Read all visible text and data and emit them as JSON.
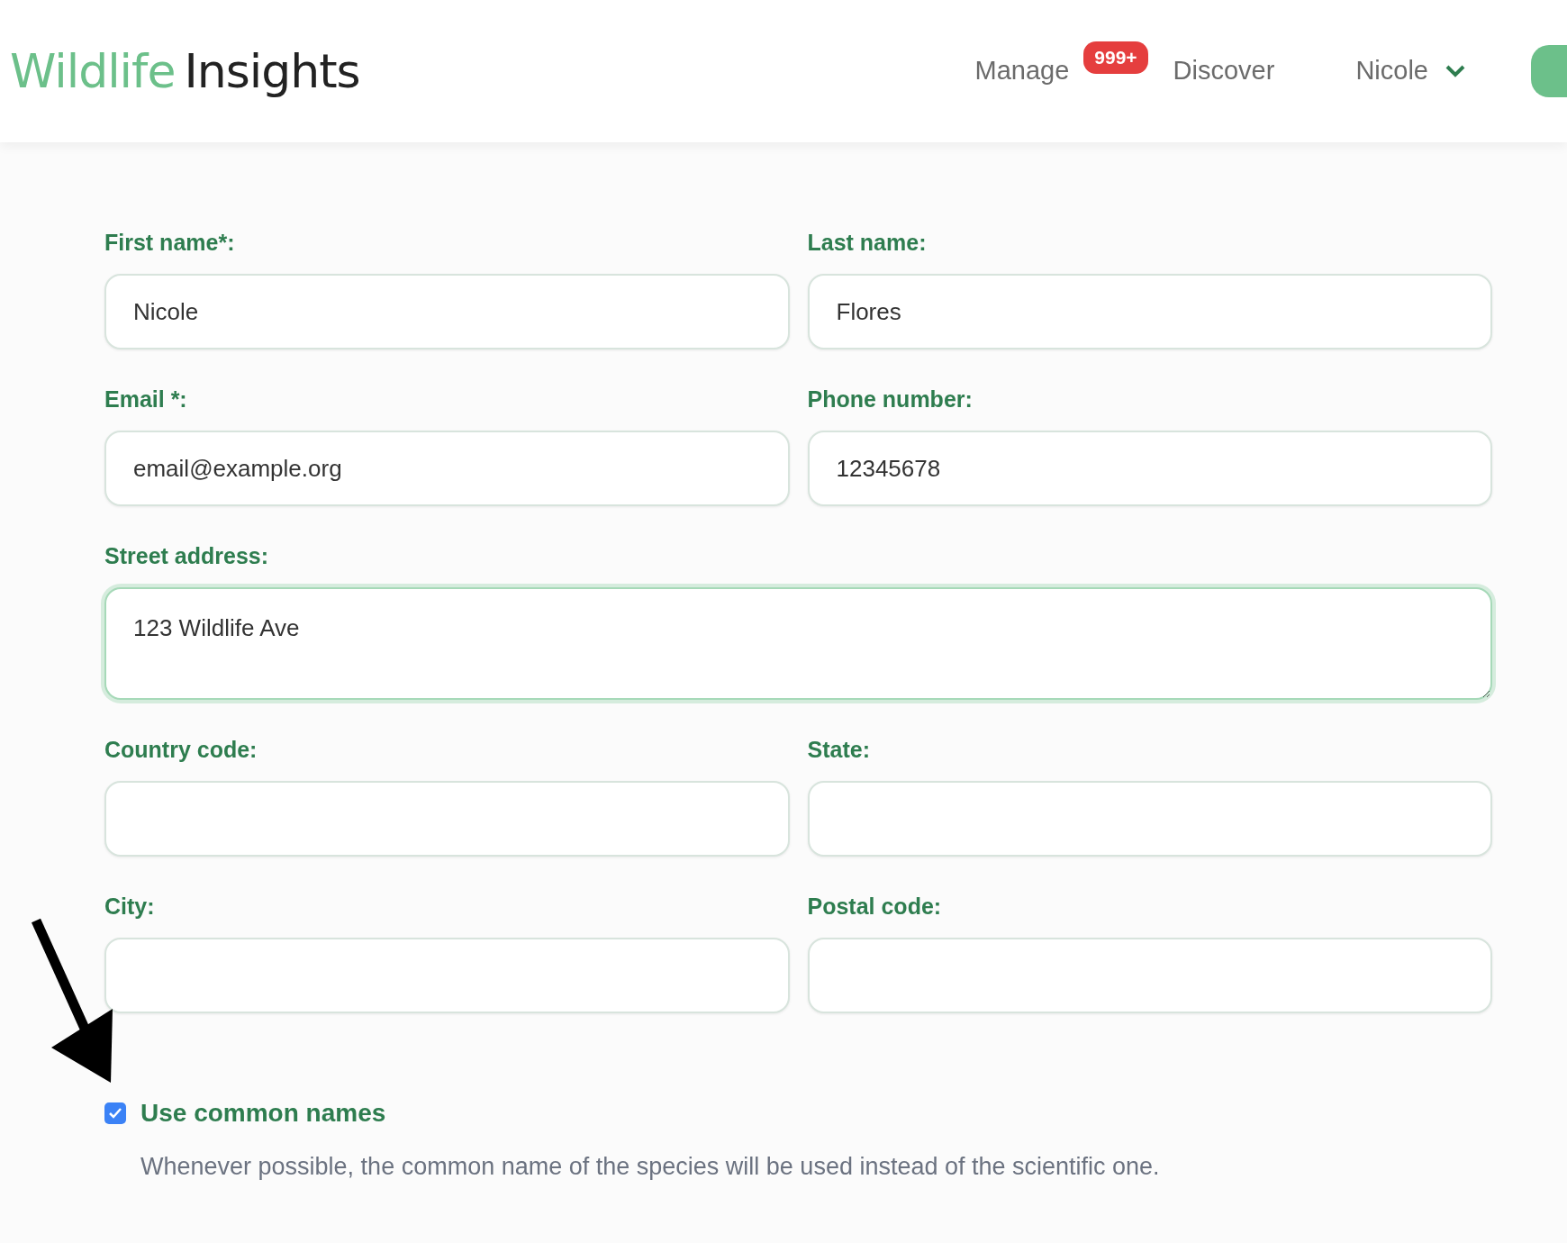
{
  "header": {
    "logo": {
      "part_1": "Wildlife",
      "part_2": "Insights"
    },
    "nav": [
      {
        "label": "Manage",
        "badge": "999+"
      },
      {
        "label": "Discover"
      }
    ],
    "user": {
      "name": "Nicole"
    }
  },
  "page": {
    "fields": [
      {
        "label": "First name*:",
        "value": "Nicole",
        "kind": "input",
        "focused": false
      },
      {
        "label": "Last name:",
        "value": "Flores",
        "kind": "input",
        "focused": false
      },
      {
        "label": "Email *:",
        "value": "email@example.org",
        "kind": "input",
        "focused": false
      },
      {
        "label": "Phone number:",
        "value": "12345678",
        "kind": "input",
        "focused": false
      },
      {
        "label": "Street address:",
        "value": "123 Wildlife Ave",
        "kind": "textarea",
        "focused": true
      },
      {
        "label": "Country code:",
        "kind": "input",
        "focused": false
      },
      {
        "label": "State:",
        "kind": "input",
        "focused": false
      },
      {
        "label": "City:",
        "kind": "input",
        "focused": false
      },
      {
        "label": "Postal code:",
        "kind": "input",
        "focused": false
      }
    ],
    "option": {
      "label": "Use common names",
      "checked": true,
      "description": "Whenever possible, the common name of the species will be used instead of the scientific one."
    }
  }
}
